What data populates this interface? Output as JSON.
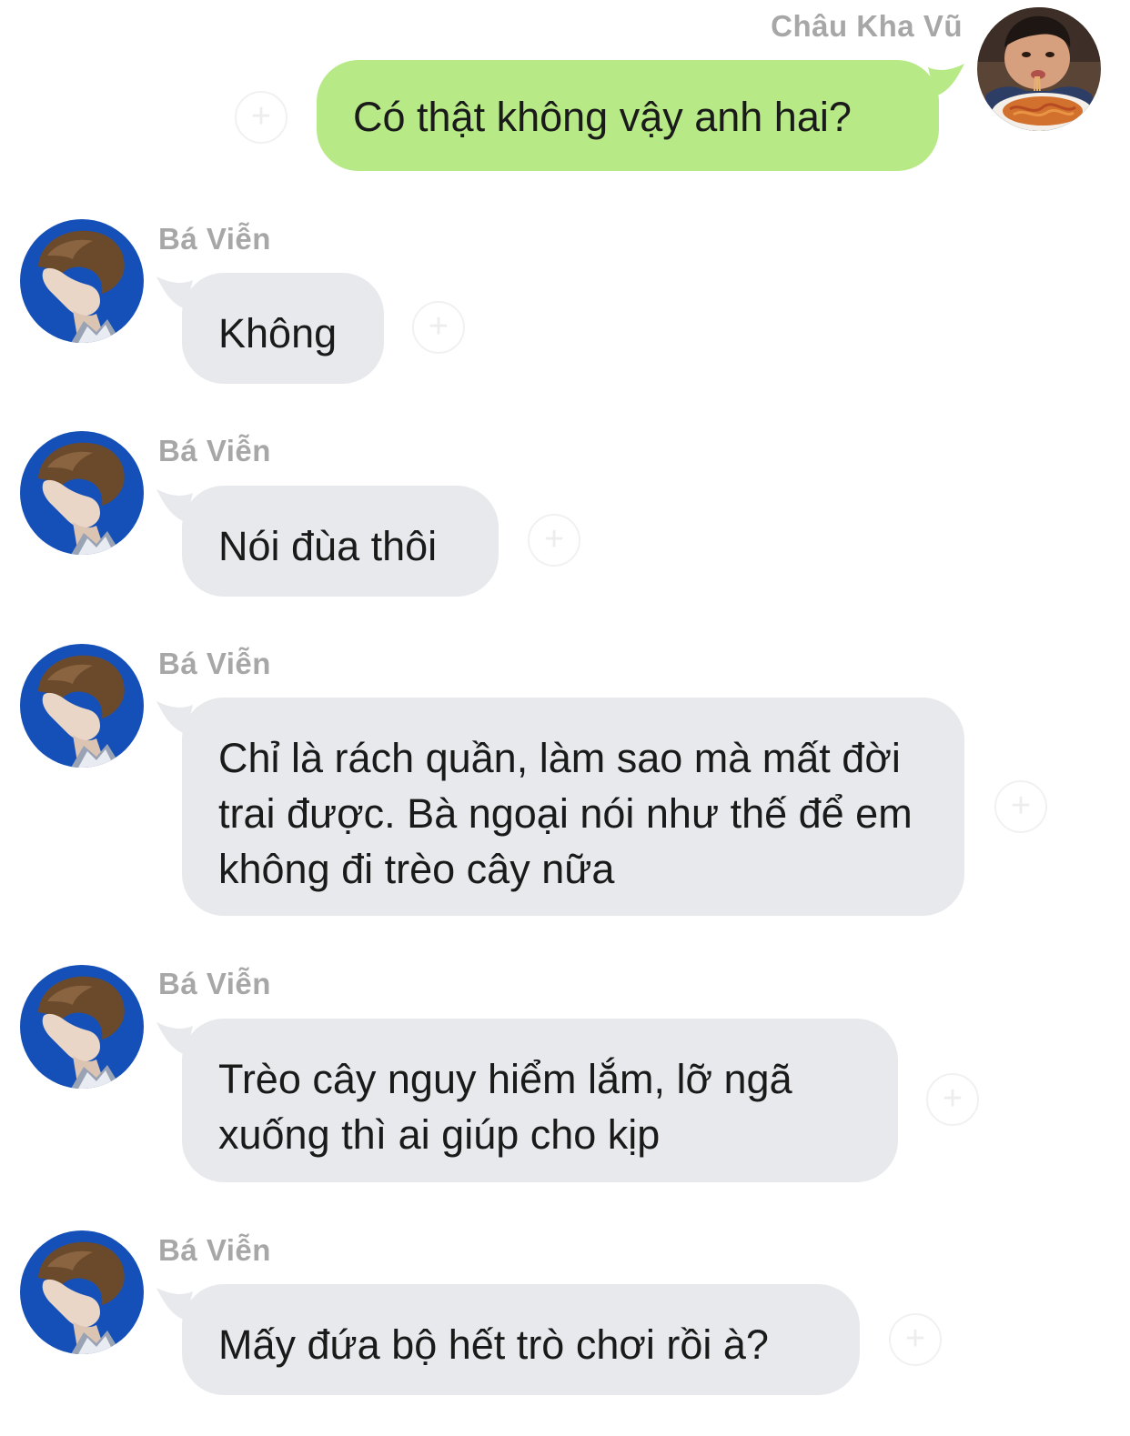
{
  "chat": {
    "self": {
      "name": "Châu Kha Vũ",
      "avatar_icon": "child-eating-spaghetti-avatar"
    },
    "contact": {
      "name": "Bá Viễn",
      "avatar_icon": "profile-portrait-blue-avatar"
    },
    "messages": [
      {
        "sender": "Châu Kha Vũ",
        "direction": "outgoing",
        "text": "Có thật không vậy anh hai?"
      },
      {
        "sender": "Bá Viễn",
        "direction": "incoming",
        "text": "Không"
      },
      {
        "sender": "Bá Viễn",
        "direction": "incoming",
        "text": "Nói đùa thôi"
      },
      {
        "sender": "Bá Viễn",
        "direction": "incoming",
        "text": "Chỉ là rách quần, làm sao mà mất đời trai được. Bà ngoại nói như thế để em không đi trèo cây nữa"
      },
      {
        "sender": "Bá Viễn",
        "direction": "incoming",
        "text": "Trèo cây nguy hiểm lắm, lỡ ngã xuống thì ai giúp cho kịp"
      },
      {
        "sender": "Bá Viễn",
        "direction": "incoming",
        "text": "Mấy đứa bộ hết trò chơi rồi à?"
      }
    ]
  },
  "colors": {
    "background": "#ffffff",
    "incoming_bubble": "#e8e9ec",
    "outgoing_bubble": "#b7ea86",
    "name_text": "#a7a7a7",
    "message_text": "#1a1a1a",
    "contact_avatar_bg": "#1550b8"
  },
  "icons": {
    "reaction": "add-reaction-icon"
  }
}
